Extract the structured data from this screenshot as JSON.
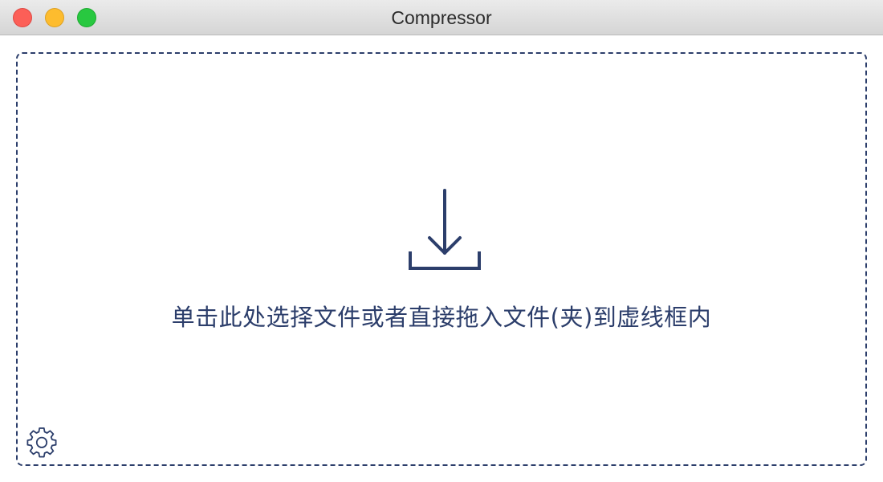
{
  "window": {
    "title": "Compressor",
    "controls": {
      "close": "close-button",
      "minimize": "minimize-button",
      "zoom": "zoom-button"
    }
  },
  "dropzone": {
    "hint": "单击此处选择文件或者直接拖入文件(夹)到虚线框内",
    "icon": "download-icon",
    "border_color": "#2c3e6b"
  },
  "footer": {
    "settings_icon": "gear-icon"
  },
  "colors": {
    "accent": "#2c3e6b",
    "close": "#fc5f57",
    "minimize": "#fdbc2e",
    "zoom": "#28c840"
  }
}
